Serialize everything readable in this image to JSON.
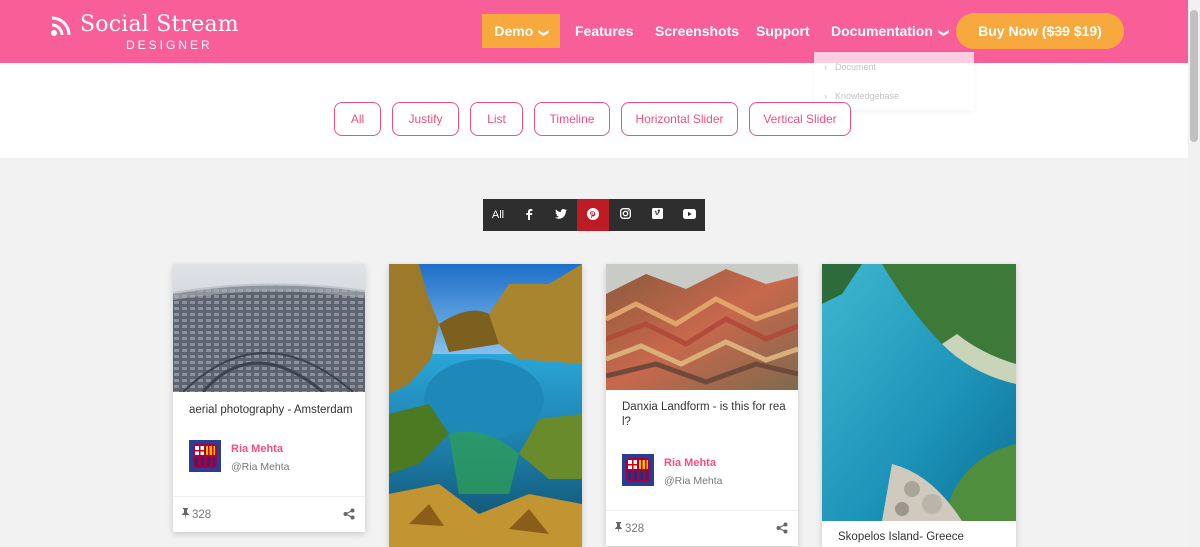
{
  "header": {
    "logo_title": "Social Stream",
    "logo_subtitle": "DESIGNER",
    "nav": [
      {
        "label": "Demo",
        "has_caret": true,
        "active": true
      },
      {
        "label": "Features"
      },
      {
        "label": "Screenshots"
      },
      {
        "label": "Support"
      },
      {
        "label": "Documentation",
        "has_caret": true
      }
    ],
    "buy": {
      "label": "Buy Now (",
      "old_price": "$39",
      "new_price": " $19)"
    },
    "dropdown": [
      "Document",
      "Knowledgebase"
    ],
    "caret": "❯",
    "colors": {
      "header_bg": "#f85e97",
      "accent": "#f8a93e"
    }
  },
  "layout_filters": [
    "All",
    "Justify",
    "List",
    "Timeline",
    "Horizontal Slider",
    "Vertical Slider"
  ],
  "social_filters": {
    "all": "All",
    "icons": [
      "facebook-icon",
      "twitter-icon",
      "pinterest-icon",
      "instagram-icon",
      "vimeo-icon",
      "youtube-icon"
    ],
    "active": "pinterest-icon",
    "active_color": "#bd1c27"
  },
  "cards": [
    {
      "text": "aerial photography - Amsterdam",
      "author": "Ria Mehta",
      "handle": "@Ria Mehta",
      "pins": "328"
    },
    {},
    {
      "text": "Danxia Landform - is this for rea l?",
      "author": "Ria Mehta",
      "handle": "@Ria Mehta",
      "pins": "328"
    },
    {
      "text": "Skopelos Island- Greece"
    }
  ]
}
